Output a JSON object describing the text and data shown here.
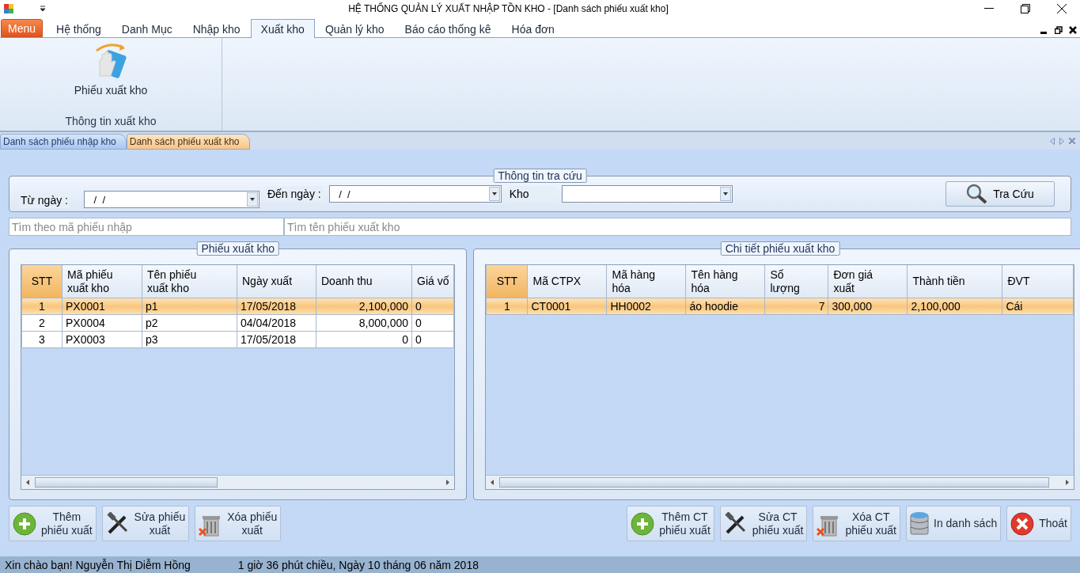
{
  "window": {
    "title": "HỆ THỐNG QUẢN LÝ XUẤT NHẬP TỒN KHO - [Danh sách phiếu xuất kho]"
  },
  "ribbon": {
    "menu_button": "Menu",
    "tabs": [
      {
        "label": "Hệ thống",
        "selected": false
      },
      {
        "label": "Danh Mục",
        "selected": false
      },
      {
        "label": "Nhập kho",
        "selected": false
      },
      {
        "label": "Xuất kho",
        "selected": true
      },
      {
        "label": "Quản lý kho",
        "selected": false
      },
      {
        "label": "Báo cáo thống kê",
        "selected": false
      },
      {
        "label": "Hóa đơn",
        "selected": false
      }
    ],
    "group": {
      "button": "Phiếu xuất kho",
      "caption": "Thông tin xuất kho"
    }
  },
  "doc_tabs": [
    {
      "label": "Danh sách phiếu nhập kho",
      "selected": false
    },
    {
      "label": "Danh sách phiếu xuất kho",
      "selected": true
    }
  ],
  "search": {
    "legend": "Thông tin tra cứu",
    "from_label": "Từ ngày :",
    "from_value": " /  /",
    "to_label": "Đến ngày :",
    "to_value": " /  /",
    "store_label": "Kho",
    "button": "Tra Cứu",
    "code_placeholder": "Tìm theo mã phiếu nhập",
    "name_placeholder": "Tìm tên phiếu xuất kho"
  },
  "left_panel": {
    "title": "Phiếu xuất kho",
    "columns": [
      "STT",
      "Mã phiếu\nxuất kho",
      "Tên phiếu\nxuất kho",
      "Ngày xuất",
      "Doanh thu",
      "Giá vố"
    ],
    "rows": [
      {
        "selected": true,
        "cells": [
          "1",
          "PX0001",
          "p1",
          "17/05/2018",
          "2,100,000",
          "0"
        ]
      },
      {
        "selected": false,
        "cells": [
          "2",
          "PX0004",
          "p2",
          "04/04/2018",
          "8,000,000",
          "0"
        ]
      },
      {
        "selected": false,
        "cells": [
          "3",
          "PX0003",
          "p3",
          "17/05/2018",
          "0",
          "0"
        ]
      }
    ]
  },
  "right_panel": {
    "title": "Chi tiết phiếu xuất kho",
    "columns": [
      "STT",
      "Mã CTPX",
      "Mã hàng\nhóa",
      "Tên hàng\nhóa",
      "Số\nlượng",
      "Đơn giá\nxuất",
      "Thành tiền",
      "ĐVT"
    ],
    "rows": [
      {
        "selected": true,
        "cells": [
          "1",
          "CT0001",
          "HH0002",
          "áo hoodie",
          "7",
          "300,000",
          "2,100,000",
          "Cái"
        ]
      }
    ]
  },
  "left_buttons": [
    {
      "kind": "add",
      "label": "Thêm\nphiếu xuất"
    },
    {
      "kind": "edit",
      "label": "Sửa phiếu\nxuất"
    },
    {
      "kind": "delete",
      "label": "Xóa phiếu\nxuất"
    }
  ],
  "right_buttons": [
    {
      "kind": "add",
      "label": "Thêm CT\nphiếu xuất"
    },
    {
      "kind": "edit",
      "label": "Sửa CT\nphiếu xuất"
    },
    {
      "kind": "delete",
      "label": "Xóa CT\nphiếu xuất"
    },
    {
      "kind": "database",
      "label": "In danh sách"
    },
    {
      "kind": "exit",
      "label": "Thoát"
    }
  ],
  "status_bar": {
    "user": "Xin chào bạn! Nguyễn Thị Diễm Hồng",
    "time": "1 giờ 36 phút chiều, Ngày 10 tháng 06 năm 2018"
  }
}
